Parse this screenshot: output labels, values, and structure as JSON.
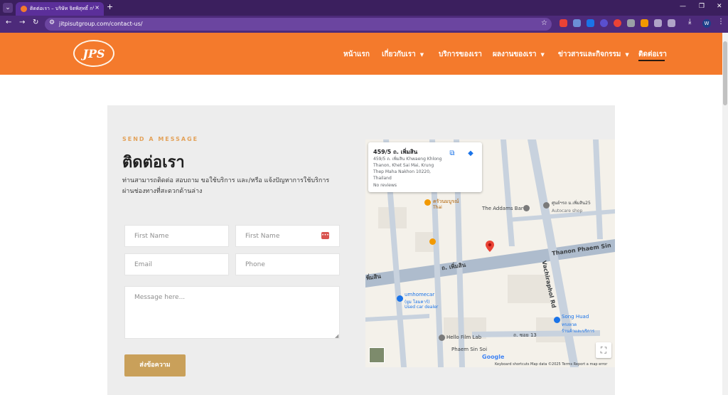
{
  "browser": {
    "tab_title": "ติดต่อเรา – บริษัท จิตพิสุทธิ์ กรุ๊ป จำกัด",
    "tab_close": "×",
    "new_tab": "+",
    "url": "jitpisutgroup.com/contact-us/",
    "menu_glyph": "⌄",
    "minimize": "—",
    "restore": "❐",
    "close": "✕",
    "back": "←",
    "forward": "→",
    "reload": "↻",
    "bookmark": "☆",
    "download": "⤓",
    "more": "⋮",
    "profile_initial": "W"
  },
  "header": {
    "logo_text": "JPS",
    "nav": [
      {
        "label": "หน้าแรก",
        "has_dropdown": false
      },
      {
        "label": "เกี่ยวกับเรา",
        "has_dropdown": true
      },
      {
        "label": "บริการของเรา",
        "has_dropdown": false
      },
      {
        "label": "ผลงานของเรา",
        "has_dropdown": true
      },
      {
        "label": "ข่าวสารและกิจกรรม",
        "has_dropdown": true
      },
      {
        "label": "ติดต่อเรา",
        "has_dropdown": false,
        "active": true
      }
    ],
    "caret": "▼"
  },
  "contact": {
    "eyebrow": "SEND A MESSAGE",
    "heading": "ติดต่อเรา",
    "description": "ท่านสามารถติดต่อ สอบถาม ขอใช้บริการ และ/หรือ แจ้งปัญหาการใช้บริการ ผ่านช่องทางที่สะดวกด้านล่าง",
    "fields": {
      "first_name_1": "First Name",
      "first_name_2": "First Name",
      "email": "Email",
      "phone": "Phone",
      "message": "Message here..."
    },
    "submit_label": "ส่งข้อความ",
    "badge_glyph": "•••",
    "resize_glyph": "◢"
  },
  "map": {
    "card_title": "459/5 ถ. เพิ่มสิน",
    "card_address": "459/5 ถ. เพิ่มสิน Khwaeng Khlong Thanon, Khet Sai Mai, Krung Thep Maha Nakhon 10220, Thailand",
    "card_reviews": "No reviews",
    "open_icon_glyph": "⧉",
    "directions_icon_glyph": "◆",
    "labels": {
      "the_addams": "The Addams Bar",
      "autocare": "ศูนย์ฯรถ ม.เพิ่มสิน25",
      "autocare_sub": "Autocare shop",
      "krua": "ครัวนมบูรณ์",
      "krua_sub": "Thai",
      "umhomecar": "umhomecar",
      "umhomecar_th": "(ยูม โฮมคาร์)",
      "umhomecar_sub": "Used car dealer",
      "hello_film": "Hello Film Lab",
      "song_huad": "Song Huad",
      "song_huad_th": "ทรงหวด",
      "song_huad_sub": "ร้านค้าและบริการ",
      "thanon_phaem_sin": "Thanon Phaem Sin",
      "phaem_sin_th": "ถ. เพิ่มสิน",
      "phaem_sin_th_short": "พิ่มสิน",
      "vachiraphol": "Vachiraphol Rd",
      "soi_13": "ถ. ซอย 13",
      "phaem_sin_soi": "Phaem Sin Soi"
    },
    "google": "Google",
    "footer": "Keyboard shortcuts   Map data ©2025   Terms   Report a map error",
    "fullscreen_glyph": "⛶"
  },
  "colors": {
    "brand_orange": "#f47a2c",
    "gold_button": "#c9a05a",
    "browser_purple": "#4d2a7a"
  }
}
